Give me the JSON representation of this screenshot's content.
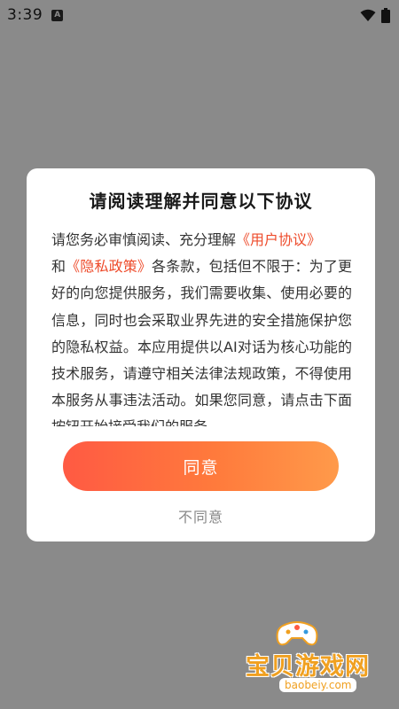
{
  "status_bar": {
    "time": "3:39",
    "notification_icon": "a-notification-icon",
    "wifi_icon": "wifi-icon",
    "battery_icon": "battery-icon"
  },
  "dialog": {
    "title": "请阅读理解并同意以下协议",
    "body_parts": {
      "p1": "请您务必审慎阅读、充分理解",
      "link_user": "《用户协议》",
      "p2": "和",
      "link_privacy": "《隐私政策》",
      "p3": "各条款，包括但不限于：为了更好的向您提供服务，我们需要收集、使用必要的信息，同时也会采取业界先进的安全措施保护您的隐私权益。本应用提供以AI对话为核心功能的技术服务，请遵守相关法律法规政策，不得使用本服务从事违法活动。如果您同意，请点击下面按钮开始接受我们的服务。"
    },
    "agree_label": "同意",
    "disagree_label": "不同意"
  },
  "watermark": {
    "text": "宝贝游戏网",
    "url": "baobeiy.com"
  },
  "colors": {
    "accent": "#ee4b2b",
    "button_start": "#ff5a43",
    "button_end": "#ff9a4a",
    "overlay": "#8a8a8a"
  }
}
